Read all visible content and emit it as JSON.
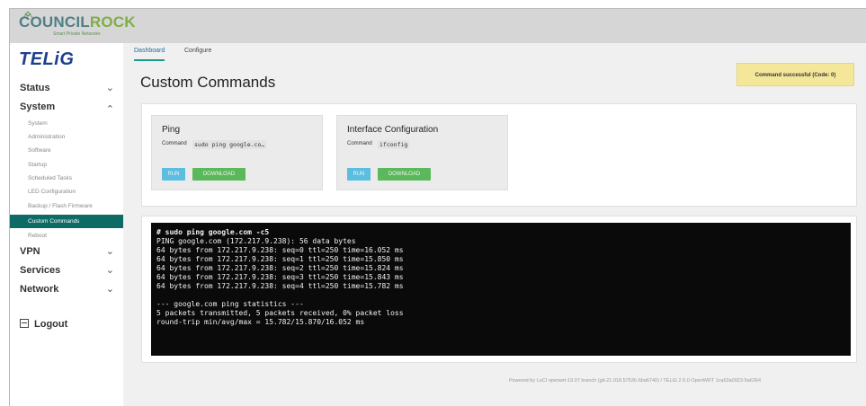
{
  "brand": {
    "name_part1": "COUNCIL",
    "name_part2": "ROCK",
    "tagline": "Smart Private Networks",
    "product_logo": "TELiG"
  },
  "header_tabs": [
    {
      "label": "Dashboard",
      "active": true
    },
    {
      "label": "Configure",
      "active": false
    }
  ],
  "sidebar": {
    "sections": [
      {
        "label": "Status",
        "chevron": "chevron-down-icon"
      },
      {
        "label": "System",
        "chevron": "chevron-up-icon"
      },
      {
        "label": "VPN",
        "chevron": "chevron-down-icon"
      },
      {
        "label": "Services",
        "chevron": "chevron-down-icon"
      },
      {
        "label": "Network",
        "chevron": "chevron-down-icon"
      }
    ],
    "system_items": [
      "System",
      "Administration",
      "Software",
      "Startup",
      "Scheduled Tasks",
      "LED Configuration",
      "Backup / Flash Firmware",
      "Custom Commands",
      "Reboot"
    ],
    "active_item": "Custom Commands",
    "logout": "Logout"
  },
  "page": {
    "title": "Custom Commands",
    "notice": "Command successful (Code: 0)"
  },
  "commands": [
    {
      "title": "Ping",
      "command_label": "Command",
      "command": "sudo ping google.co…",
      "run_label": "RUN",
      "download_label": "DOWNLOAD"
    },
    {
      "title": "Interface Configuration",
      "command_label": "Command",
      "command": "ifconfig",
      "run_label": "RUN",
      "download_label": "DOWNLOAD"
    }
  ],
  "terminal": {
    "lines": [
      "# sudo ping google.com -c5",
      "PING google.com (172.217.9.238): 56 data bytes",
      "64 bytes from 172.217.9.238: seq=0 ttl=250 time=16.052 ms",
      "64 bytes from 172.217.9.238: seq=1 ttl=250 time=15.850 ms",
      "64 bytes from 172.217.9.238: seq=2 ttl=250 time=15.824 ms",
      "64 bytes from 172.217.9.238: seq=3 ttl=250 time=15.843 ms",
      "64 bytes from 172.217.9.238: seq=4 ttl=250 time=15.782 ms",
      "",
      "--- google.com ping statistics ---",
      "5 packets transmitted, 5 packets received, 0% packet loss",
      "round-trip min/avg/max = 15.782/15.870/16.052 ms"
    ]
  },
  "footer": "Powered by LuCI openwrt-19.07 branch (git-21.018.57536-6ba6740) / TELiG 2.5.0 OpenWRT 1ca63a0923-5a6364",
  "colors": {
    "accent": "#0d6b66",
    "run_button": "#5bbde0",
    "download_button": "#5cb85c",
    "notice_bg": "#f4e79a",
    "logo_blue": "#1f3f8f"
  }
}
